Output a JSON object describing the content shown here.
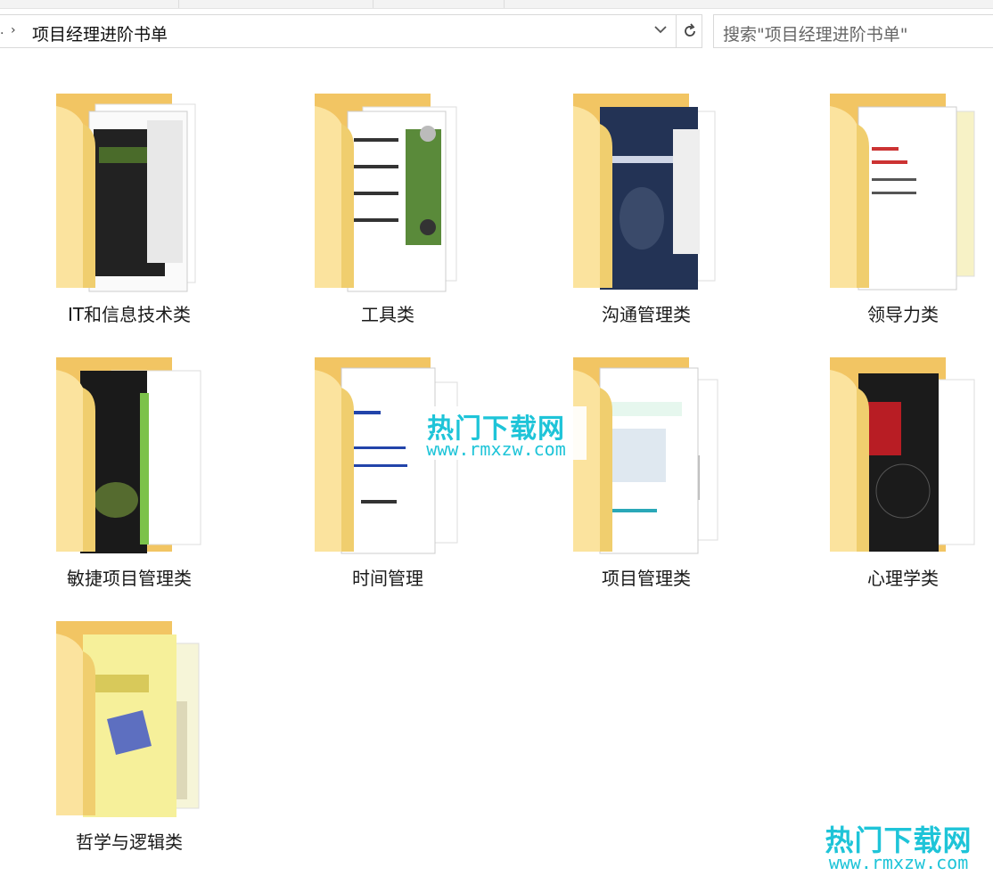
{
  "address_bar": {
    "path": "项目经理进阶书单",
    "separator": "›",
    "dropdown_icon": "chevron-down-icon",
    "refresh_icon": "refresh-icon"
  },
  "search": {
    "placeholder": "搜索\"项目经理进阶书单\""
  },
  "folders": [
    {
      "label": "IT和信息技术类",
      "preview": "books"
    },
    {
      "label": "工具类",
      "preview": "books"
    },
    {
      "label": "沟通管理类",
      "preview": "books"
    },
    {
      "label": "领导力类",
      "preview": "books"
    },
    {
      "label": "敏捷项目管理类",
      "preview": "books"
    },
    {
      "label": "时间管理",
      "preview": "documents"
    },
    {
      "label": "项目管理类",
      "preview": "books"
    },
    {
      "label": "心理学类",
      "preview": "books"
    },
    {
      "label": "哲学与逻辑类",
      "preview": "books"
    }
  ],
  "watermark": {
    "title": "热门下载网",
    "url": "www.rmxzw.com",
    "color": "#1ec4d8"
  },
  "colors": {
    "folder_back": "#f2c563",
    "folder_front": "#fbe39e"
  }
}
